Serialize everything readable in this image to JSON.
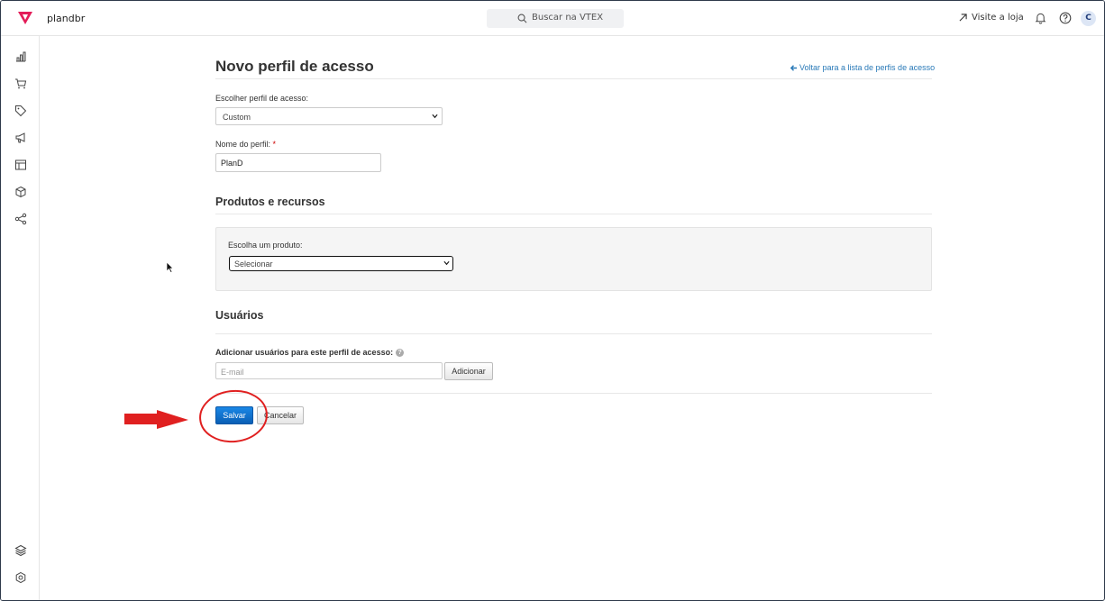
{
  "topbar": {
    "store_name": "plandbr",
    "search_placeholder": "Buscar na VTEX",
    "visit_store": "Visite a loja",
    "avatar_initial": "C",
    "brand_color": "#e31c58"
  },
  "sidebar": {
    "icons": [
      "analytics-icon",
      "cart-icon",
      "tag-icon",
      "megaphone-icon",
      "layout-icon",
      "box-icon",
      "share-icon",
      "layers-icon",
      "settings-icon"
    ]
  },
  "page": {
    "title": "Novo perfil de acesso",
    "back_link": "Voltar para a lista de perfis de acesso",
    "profile_select_label": "Escolher perfil de acesso:",
    "profile_select_value": "Custom",
    "profile_name_label": "Nome do perfil:",
    "required_mark": "*",
    "profile_name_value": "PlanD"
  },
  "products": {
    "section_title": "Produtos e recursos",
    "product_label": "Escolha um produto:",
    "product_select_value": "Selecionar"
  },
  "users": {
    "section_title": "Usuários",
    "add_label": "Adicionar usuários para este perfil de acesso:",
    "info_glyph": "?",
    "email_placeholder": "E-mail",
    "add_button": "Adicionar"
  },
  "actions": {
    "save_button": "Salvar",
    "cancel_button": "Cancelar"
  },
  "annotation": {
    "color": "#e02020"
  }
}
